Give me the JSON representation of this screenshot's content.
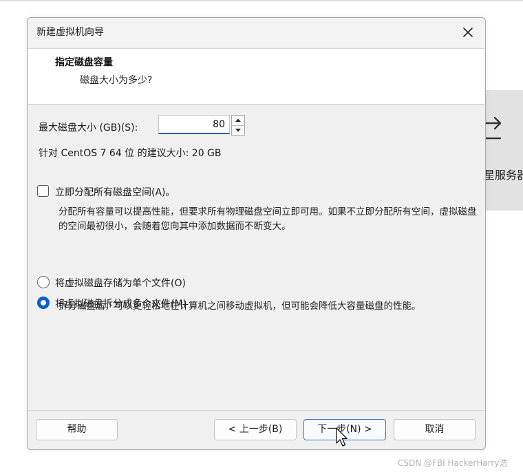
{
  "background": {
    "panel_text": "星服务器",
    "panel_icon": "swap-arrow-icon"
  },
  "dialog": {
    "title": "新建虚拟机向导",
    "header_title": "指定磁盘容量",
    "header_subtitle": "磁盘大小为多少?",
    "disk_size": {
      "label": "最大磁盘大小 (GB)(S):",
      "value": "80"
    },
    "recommendation": "针对 CentOS 7 64 位 的建议大小: 20 GB",
    "allocate_now": {
      "label": "立即分配所有磁盘空间(A)。",
      "checked": false,
      "description": "分配所有容量可以提高性能，但要求所有物理磁盘空间立即可用。如果不立即分配所有空间，虚拟磁盘的空间最初很小，会随着您向其中添加数据而不断变大。"
    },
    "storage_options": [
      {
        "label": "将虚拟磁盘存储为单个文件(O)",
        "selected": false
      },
      {
        "label": "将虚拟磁盘拆分成多个文件(M)",
        "selected": true
      }
    ],
    "split_description": "拆分磁盘后，可以更轻松地在计算机之间移动虚拟机，但可能会降低大容量磁盘的性能。",
    "buttons": {
      "help": "帮助",
      "back": "< 上一步(B)",
      "next": "下一步(N) >",
      "cancel": "取消"
    }
  },
  "watermark": "CSDN @FBI HackerHarry浩",
  "colors": {
    "accent": "#0a5fc6",
    "dialog_bg": "#f0f0f0",
    "header_bg": "#ffffff"
  }
}
